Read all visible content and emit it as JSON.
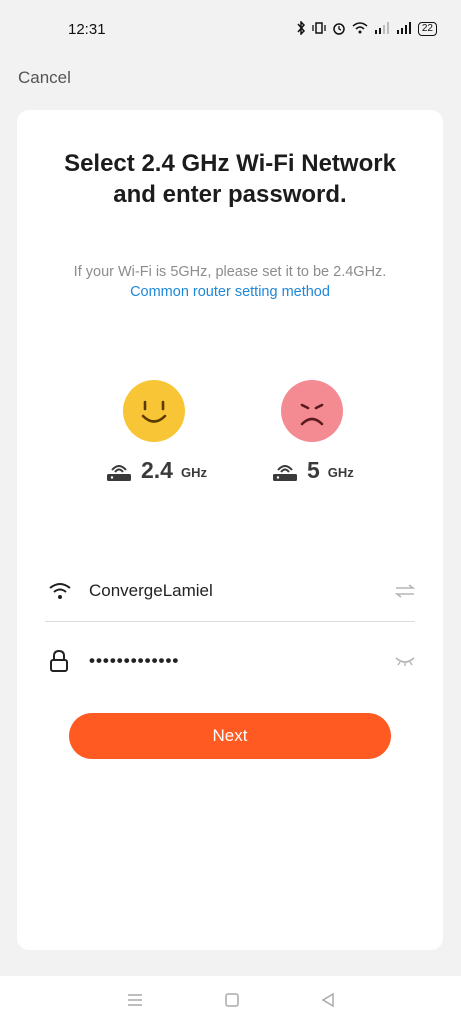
{
  "status_bar": {
    "time": "12:31",
    "battery": "22",
    "icons": [
      "bluetooth-icon",
      "vibrate-icon",
      "alarm-icon",
      "wifi-icon",
      "signal-icon",
      "signal-icon",
      "battery-icon"
    ]
  },
  "header": {
    "cancel_label": "Cancel"
  },
  "card": {
    "title": "Select 2.4 GHz Wi-Fi Network and enter password.",
    "hint_text": "If your Wi-Fi is 5GHz, please set it to be 2.4GHz.",
    "hint_link": "Common router setting method",
    "bands": [
      {
        "value": "2.4",
        "unit": "GHz",
        "face": "smiley-face-icon"
      },
      {
        "value": "5",
        "unit": "GHz",
        "face": "sad-face-icon"
      }
    ],
    "ssid_value": "ConvergeLamiel",
    "password_value": "•••••••••••••",
    "next_label": "Next"
  },
  "colors": {
    "accent": "#ff5a22",
    "link": "#1e88d8",
    "happy": "#f7c536",
    "sad": "#f48a92"
  }
}
